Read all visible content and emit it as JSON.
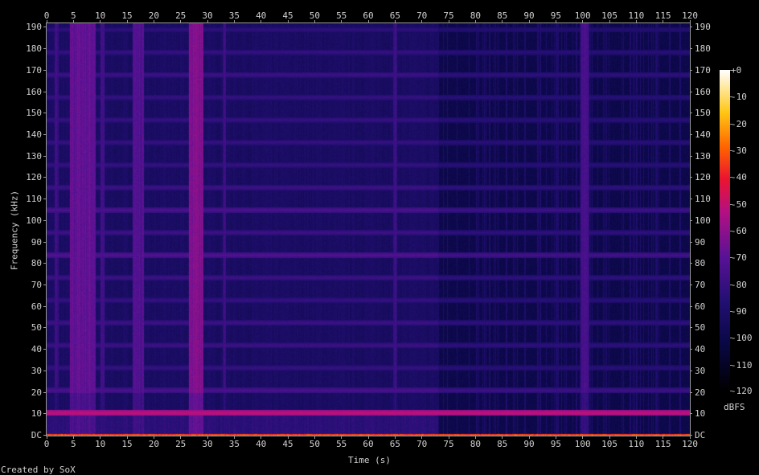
{
  "footer": "Created by SoX",
  "chart_data": {
    "type": "heatmap",
    "subtype": "spectrogram",
    "title": "",
    "xlabel": "Time (s)",
    "ylabel": "Frequency (kHz)",
    "xlim": [
      0,
      120
    ],
    "ylim": [
      0,
      192
    ],
    "x_ticks": [
      "0",
      "5",
      "10",
      "15",
      "20",
      "25",
      "30",
      "35",
      "40",
      "45",
      "50",
      "55",
      "60",
      "65",
      "70",
      "75",
      "80",
      "85",
      "90",
      "95",
      "100",
      "105",
      "110",
      "115",
      "120"
    ],
    "y_ticks": [
      "DC",
      "10",
      "20",
      "30",
      "40",
      "50",
      "60",
      "70",
      "80",
      "90",
      "100",
      "110",
      "120",
      "130",
      "140",
      "150",
      "160",
      "170",
      "180",
      "190"
    ],
    "colorbar": {
      "label": "dBFS",
      "range": [
        -120,
        0
      ],
      "ticks": [
        "+0",
        "-10",
        "-20",
        "-30",
        "-40",
        "-50",
        "-60",
        "-70",
        "-80",
        "-90",
        "-100",
        "-110",
        "-120"
      ]
    },
    "background_level_db": -92,
    "segment_change_s": 73,
    "after_change_background_db": -100,
    "dc_level_db": -30,
    "harmonic_lines": [
      {
        "freq_khz": 10.5,
        "level_db": -50
      },
      {
        "freq_khz": 21,
        "level_db": -74
      },
      {
        "freq_khz": 31.5,
        "level_db": -80
      },
      {
        "freq_khz": 42,
        "level_db": -78
      },
      {
        "freq_khz": 52.5,
        "level_db": -78
      },
      {
        "freq_khz": 63,
        "level_db": -80
      },
      {
        "freq_khz": 73.5,
        "level_db": -78
      },
      {
        "freq_khz": 84,
        "level_db": -72
      },
      {
        "freq_khz": 94.5,
        "level_db": -78
      },
      {
        "freq_khz": 105,
        "level_db": -74
      },
      {
        "freq_khz": 115.5,
        "level_db": -78
      },
      {
        "freq_khz": 126,
        "level_db": -80
      },
      {
        "freq_khz": 136.5,
        "level_db": -80
      },
      {
        "freq_khz": 147,
        "level_db": -80
      },
      {
        "freq_khz": 157.5,
        "level_db": -80
      },
      {
        "freq_khz": 168,
        "level_db": -78
      },
      {
        "freq_khz": 178.5,
        "level_db": -80
      },
      {
        "freq_khz": 189,
        "level_db": -82
      }
    ],
    "vertical_bands": [
      {
        "start_s": 1.5,
        "end_s": 2.3,
        "level_db": -80
      },
      {
        "start_s": 4.3,
        "end_s": 9.2,
        "level_db": -68
      },
      {
        "start_s": 10.0,
        "end_s": 10.8,
        "level_db": -78
      },
      {
        "start_s": 16.0,
        "end_s": 18.2,
        "level_db": -72
      },
      {
        "start_s": 26.5,
        "end_s": 29.2,
        "level_db": -62
      },
      {
        "start_s": 32.8,
        "end_s": 33.4,
        "level_db": -78
      },
      {
        "start_s": 64.6,
        "end_s": 65.4,
        "level_db": -80
      },
      {
        "start_s": 99.6,
        "end_s": 101.2,
        "level_db": -76
      }
    ]
  }
}
